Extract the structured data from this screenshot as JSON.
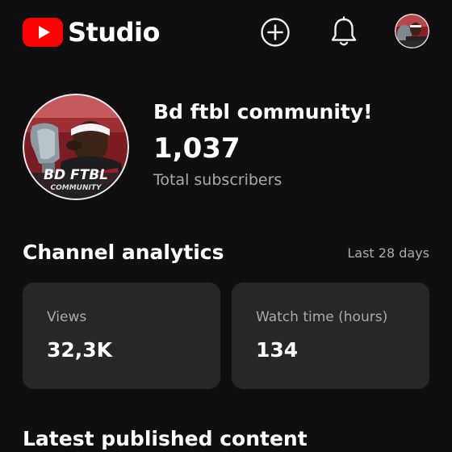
{
  "header": {
    "app_title": "Studio",
    "brand_color": "#ff0000",
    "icons": [
      "youtube-logo",
      "create-icon",
      "notifications-bell-icon",
      "account-avatar"
    ]
  },
  "channel": {
    "name": "Bd ftbl community!",
    "subscriber_count": "1,037",
    "subscriber_label": "Total subscribers",
    "avatar_text": {
      "line1": "BD FTBL",
      "line2": "COMMUNITY"
    }
  },
  "analytics": {
    "title": "Channel analytics",
    "period": "Last 28 days",
    "cards": [
      {
        "label": "Views",
        "value": "32,3K"
      },
      {
        "label": "Watch time (hours)",
        "value": "134"
      }
    ]
  },
  "latest": {
    "title": "Latest published content"
  }
}
